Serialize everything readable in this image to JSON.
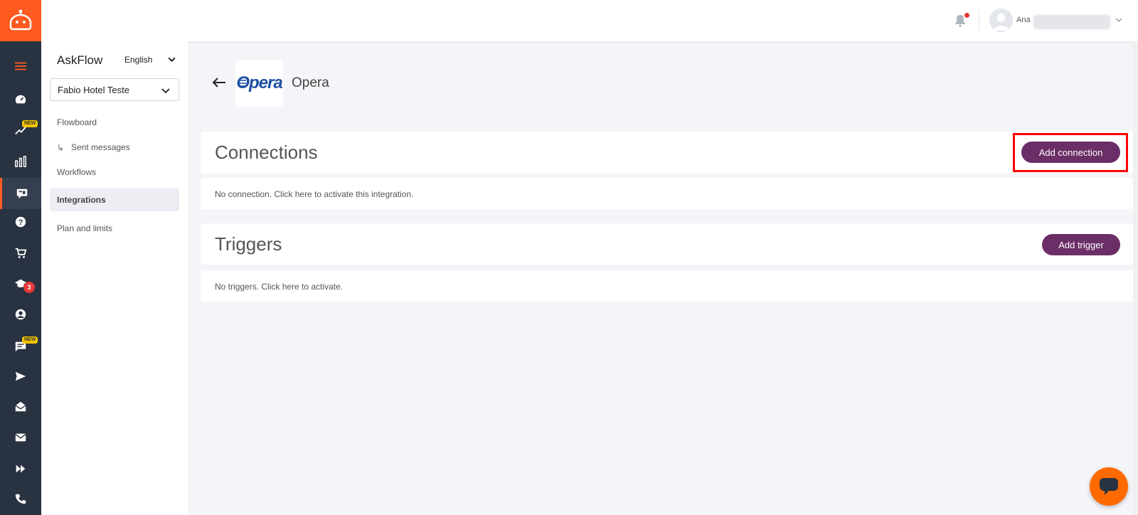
{
  "sidebar": {
    "app_title": "AskFlow",
    "language": "English",
    "hotel_select": "Fabio Hotel Teste",
    "items": [
      {
        "label": "Flowboard"
      },
      {
        "label": "Sent messages"
      },
      {
        "label": "Workflows"
      },
      {
        "label": "Integrations"
      },
      {
        "label": "Plan and limits"
      }
    ]
  },
  "rail": {
    "icons": [
      "menu-icon",
      "dashboard-icon",
      "trending-icon",
      "bar-chart-icon",
      "chat-card-icon",
      "help-icon",
      "cart-icon",
      "graduation-cap-icon",
      "account-icon",
      "chat-icon",
      "send-icon",
      "inbox-icon",
      "mail-icon",
      "fast-forward-icon",
      "phone-icon"
    ],
    "new_badge": "NEW",
    "count_badge": "3"
  },
  "header": {
    "user_name": "Ana"
  },
  "integration": {
    "logo_text": "Opera",
    "title": "Opera"
  },
  "connections": {
    "title": "Connections",
    "button": "Add connection",
    "message": "No connection. Click here to activate this integration."
  },
  "triggers": {
    "title": "Triggers",
    "button": "Add trigger",
    "message": "No triggers. Click here to activate."
  },
  "colors": {
    "accent": "#ff5a1f",
    "button": "#6b2e66",
    "rail": "#283241",
    "highlight": "#ff0000"
  }
}
